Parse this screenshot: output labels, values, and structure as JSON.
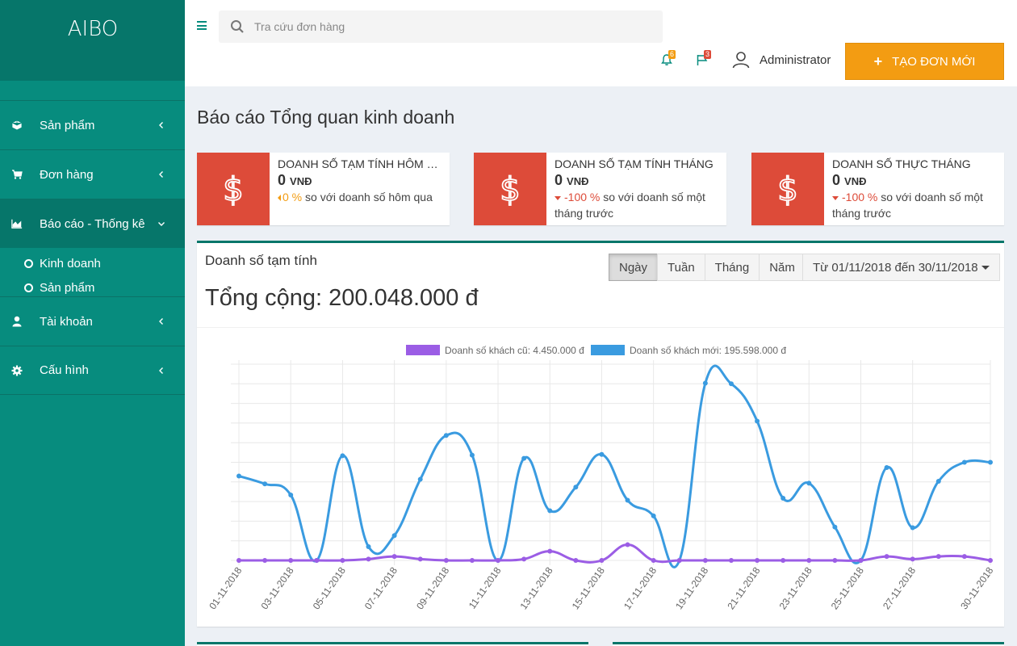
{
  "brand": {
    "logo": "AIBO"
  },
  "sidebar": {
    "items": [
      {
        "label": "Sản phẩm",
        "icon": "cube-icon"
      },
      {
        "label": "Đơn hàng",
        "icon": "cart-icon"
      },
      {
        "label": "Báo cáo - Thống kê",
        "icon": "area-chart-icon",
        "expanded": true,
        "children": [
          {
            "label": "Kinh doanh"
          },
          {
            "label": "Sản phẩm"
          }
        ]
      },
      {
        "label": "Tài khoản",
        "icon": "user-icon"
      },
      {
        "label": "Cấu hình",
        "icon": "gear-icon"
      }
    ]
  },
  "header": {
    "search_placeholder": "Tra cứu đơn hàng",
    "notifications_count": "6",
    "flags_count": "3",
    "user_name": "Administrator",
    "new_order_label": "TẠO ĐƠN MỚI"
  },
  "page": {
    "title": "Báo cáo Tổng quan kinh doanh"
  },
  "stats": [
    {
      "title": "DOANH SỐ TẠM TÍNH HÔM NAY",
      "value": "0",
      "unit": "VNĐ",
      "pct": "0 %",
      "desc": "so với doanh số hôm qua",
      "trend": "neutral"
    },
    {
      "title": "DOANH SỐ TẠM TÍNH THÁNG",
      "value": "0",
      "unit": "VNĐ",
      "pct": "-100 %",
      "desc": "so với doanh số một tháng trước",
      "trend": "down"
    },
    {
      "title": "DOANH SỐ THỰC THÁNG",
      "value": "0",
      "unit": "VNĐ",
      "pct": "-100 %",
      "desc": "so với doanh số một tháng trước",
      "trend": "down"
    }
  ],
  "panel": {
    "title": "Doanh số tạm tính",
    "total": "Tổng cộng: 200.048.000 đ",
    "period_buttons": [
      "Ngày",
      "Tuần",
      "Tháng",
      "Năm"
    ],
    "active_period": "Ngày",
    "date_range": "Từ 01/11/2018 đến 30/11/2018"
  },
  "colors": {
    "sidebar": "#078c7e",
    "accent_orange": "#f39c12",
    "danger": "#dd4b39",
    "series_old": "#9b5de5",
    "series_new": "#3a9be0"
  },
  "chart_data": {
    "type": "line",
    "x": [
      "01-11-2018",
      "02-11-2018",
      "03-11-2018",
      "04-11-2018",
      "05-11-2018",
      "06-11-2018",
      "07-11-2018",
      "08-11-2018",
      "09-11-2018",
      "10-11-2018",
      "11-11-2018",
      "12-11-2018",
      "13-11-2018",
      "14-11-2018",
      "15-11-2018",
      "16-11-2018",
      "17-11-2018",
      "18-11-2018",
      "19-11-2018",
      "20-11-2018",
      "21-11-2018",
      "22-11-2018",
      "23-11-2018",
      "24-11-2018",
      "25-11-2018",
      "26-11-2018",
      "27-11-2018",
      "28-11-2018",
      "29-11-2018",
      "30-11-2018"
    ],
    "x_tick_labels": [
      "01-11-2018",
      "03-11-2018",
      "05-11-2018",
      "07-11-2018",
      "09-11-2018",
      "11-11-2018",
      "13-11-2018",
      "15-11-2018",
      "17-11-2018",
      "19-11-2018",
      "21-11-2018",
      "23-11-2018",
      "25-11-2018",
      "27-11-2018",
      "30-11-2018"
    ],
    "series": [
      {
        "name": "Doanh số khách cũ: 4.450.000 đ",
        "color": "#9b5de5",
        "values": [
          0,
          0,
          0,
          0,
          0,
          0.2,
          0.6,
          0.2,
          0,
          0,
          0,
          0.2,
          1.4,
          0,
          0,
          2.4,
          0,
          0,
          0,
          0,
          0,
          0,
          0,
          0,
          0,
          0.6,
          0.2,
          0.6,
          0.6,
          0
        ]
      },
      {
        "name": "Doanh số khách mới: 195.598.000 đ",
        "color": "#3a9be0",
        "values": [
          12.9,
          11.7,
          10.0,
          0,
          16.0,
          2.1,
          3.8,
          12.4,
          19.1,
          16.1,
          0,
          15.6,
          7.6,
          11.2,
          16.2,
          9.2,
          6.8,
          0,
          27.1,
          27.0,
          21.3,
          9.5,
          11.8,
          5.1,
          0,
          14.2,
          5.0,
          12.1,
          15.0,
          15.0
        ]
      }
    ],
    "ylim": [
      0,
      30
    ],
    "grid": true,
    "legend_position": "top"
  }
}
